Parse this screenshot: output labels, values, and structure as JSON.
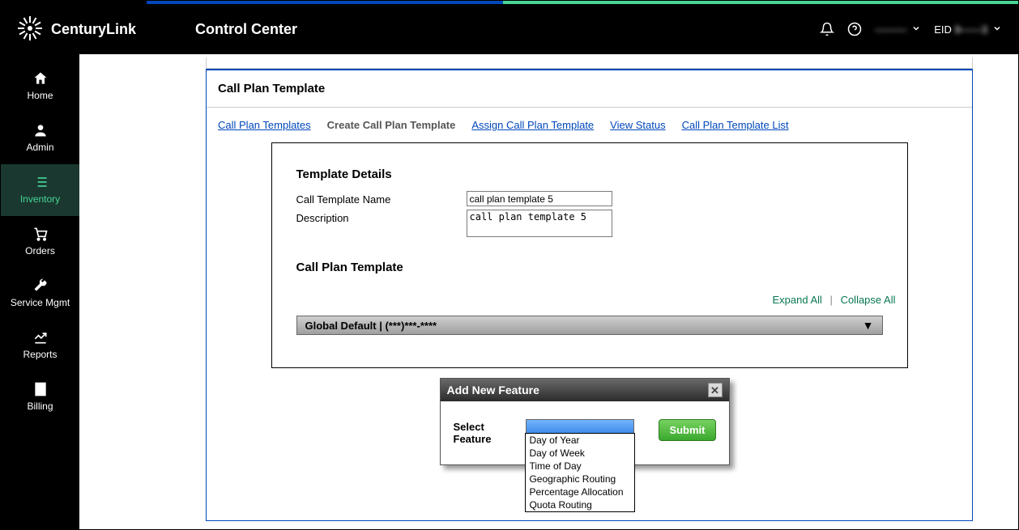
{
  "header": {
    "brand": "CenturyLink",
    "app_title": "Control Center",
    "user_label": "———",
    "eid_label": "EID 9——3"
  },
  "sidebar": {
    "items": [
      {
        "label": "Home"
      },
      {
        "label": "Admin"
      },
      {
        "label": "Inventory"
      },
      {
        "label": "Orders"
      },
      {
        "label": "Service Mgmt"
      },
      {
        "label": "Reports"
      },
      {
        "label": "Billing"
      }
    ]
  },
  "page": {
    "title": "Call Plan Template",
    "breadcrumb": [
      {
        "label": "Call Plan Templates",
        "link": true
      },
      {
        "label": "Create Call Plan Template",
        "link": false
      },
      {
        "label": "Assign Call Plan Template",
        "link": true
      },
      {
        "label": "View Status",
        "link": true
      },
      {
        "label": "Call Plan Template List",
        "link": true
      }
    ]
  },
  "form": {
    "section_details": "Template Details",
    "name_label": "Call Template Name",
    "name_value": "call plan template 5",
    "desc_label": "Description",
    "desc_value": "call plan template 5",
    "section_plan": "Call Plan Template",
    "expand_all": "Expand All",
    "collapse_all": "Collapse All",
    "accordion_label": "Global Default | (***)***-****"
  },
  "modal": {
    "title": "Add New Feature",
    "select_label": "Select Feature",
    "submit": "Submit",
    "options": [
      "Day of Year",
      "Day of Week",
      "Time of Day",
      "Geographic Routing",
      "Percentage Allocation",
      "Quota Routing"
    ]
  }
}
